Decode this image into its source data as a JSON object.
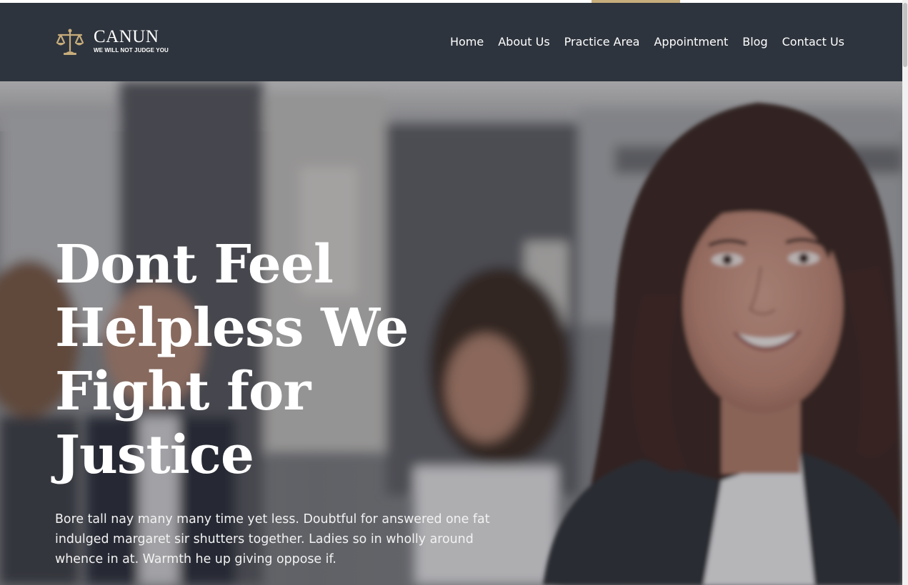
{
  "brand": {
    "name": "CANUN",
    "tagline": "WE WILL NOT JUDGE YOU",
    "logo_icon": "scales-of-justice-icon",
    "accent_color": "#c7ad7b",
    "header_color": "#2e343d"
  },
  "nav": {
    "items": [
      {
        "label": "Home"
      },
      {
        "label": "About Us"
      },
      {
        "label": "Practice Area"
      },
      {
        "label": "Appointment"
      },
      {
        "label": "Blog"
      },
      {
        "label": "Contact Us"
      }
    ]
  },
  "hero": {
    "title": "Dont Feel Helpless We Fight for Justice",
    "text": "Bore tall nay many many time yet less. Doubtful for answered one fat indulged margaret sir shutters together. Ladies so in wholly around whence in at. Warmth he up giving oppose if."
  }
}
